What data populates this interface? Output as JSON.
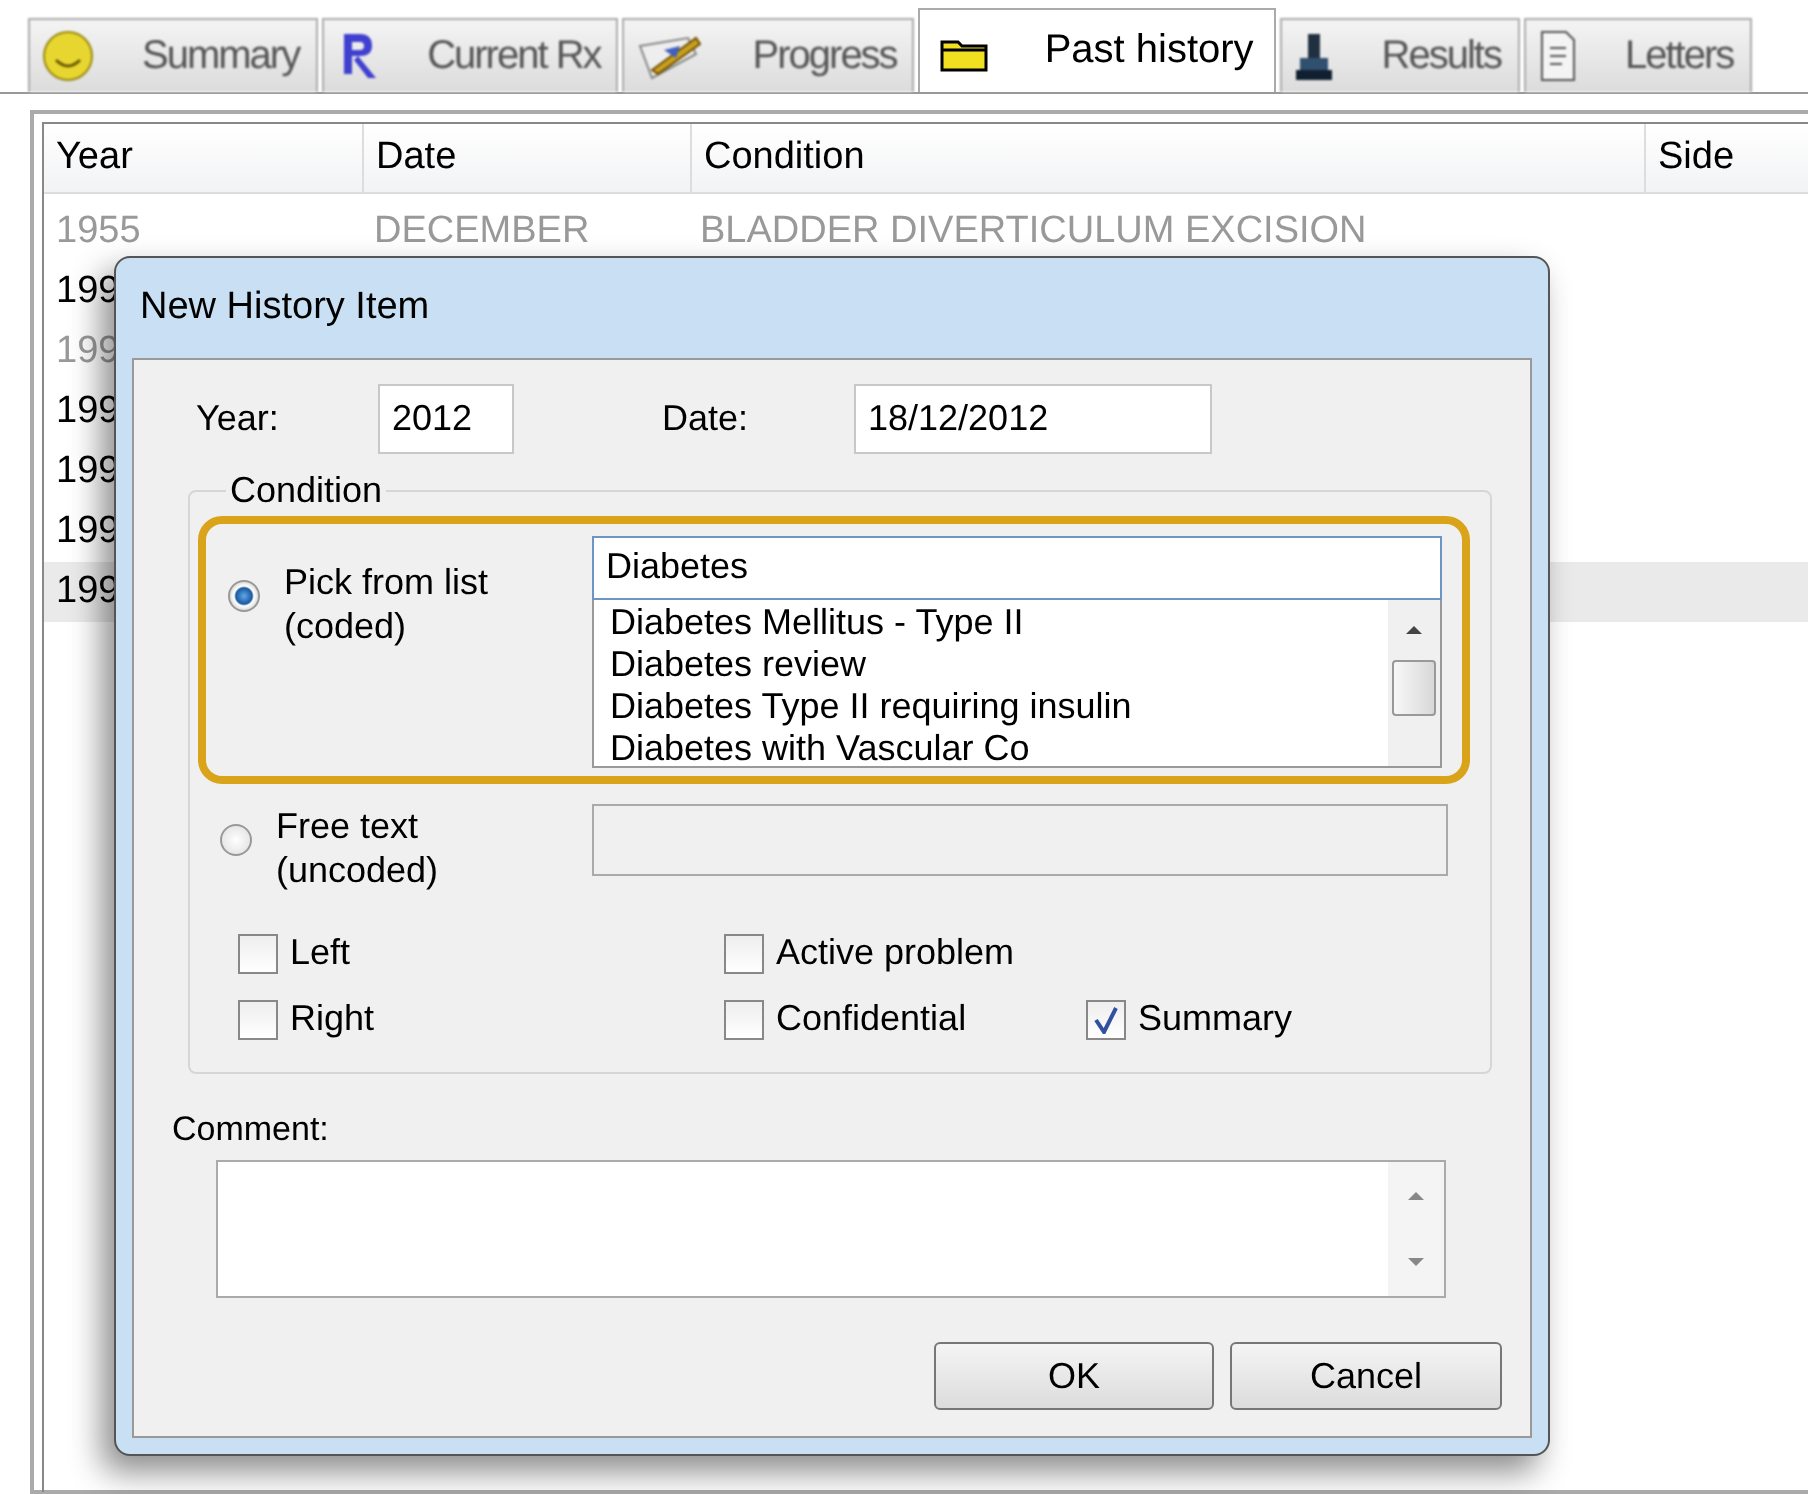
{
  "tabs": [
    {
      "label": "Summary",
      "selected": false
    },
    {
      "label": "Current Rx",
      "selected": false
    },
    {
      "label": "Progress",
      "selected": false
    },
    {
      "label": "Past history",
      "selected": true
    },
    {
      "label": "Results",
      "selected": false
    },
    {
      "label": "Letters",
      "selected": false
    }
  ],
  "table": {
    "columns": [
      "Year",
      "Date",
      "Condition",
      "Side"
    ],
    "rows": [
      {
        "cells": [
          "1955",
          "DECEMBER",
          "BLADDER DIVERTICULUM EXCISION"
        ],
        "greyed": true,
        "selected": false
      },
      {
        "cells": [
          "199"
        ],
        "greyed": false,
        "selected": false
      },
      {
        "cells": [
          "199"
        ],
        "greyed": true,
        "selected": false
      },
      {
        "cells": [
          "199"
        ],
        "greyed": false,
        "selected": false
      },
      {
        "cells": [
          "199"
        ],
        "greyed": false,
        "selected": false
      },
      {
        "cells": [
          "199"
        ],
        "greyed": false,
        "selected": false
      },
      {
        "cells": [
          "199"
        ],
        "greyed": false,
        "selected": true
      }
    ]
  },
  "dialog": {
    "title": "New History Item",
    "year_label": "Year:",
    "year": "2012",
    "date_label": "Date:",
    "date": "18/12/2012",
    "condition_legend": "Condition",
    "pick": {
      "label": "Pick from list (coded)",
      "selected": true,
      "search": "Diabetes",
      "list": [
        "Diabetes Mellitus - Type II",
        "Diabetes review",
        "Diabetes Type II requiring insulin",
        "Diabetes with Vascular Co"
      ]
    },
    "free": {
      "label": "Free text (uncoded)",
      "selected": false
    },
    "checkbox_rows": [
      [
        {
          "label": "Left",
          "checked": false
        },
        {
          "label": "Active problem",
          "checked": false
        }
      ],
      [
        {
          "label": "Right",
          "checked": false
        },
        {
          "label": "Confidential",
          "checked": false
        },
        {
          "label": "Summary",
          "checked": true
        }
      ]
    ],
    "comment_label": "Comment:",
    "buttons": [
      "OK",
      "Cancel"
    ]
  }
}
